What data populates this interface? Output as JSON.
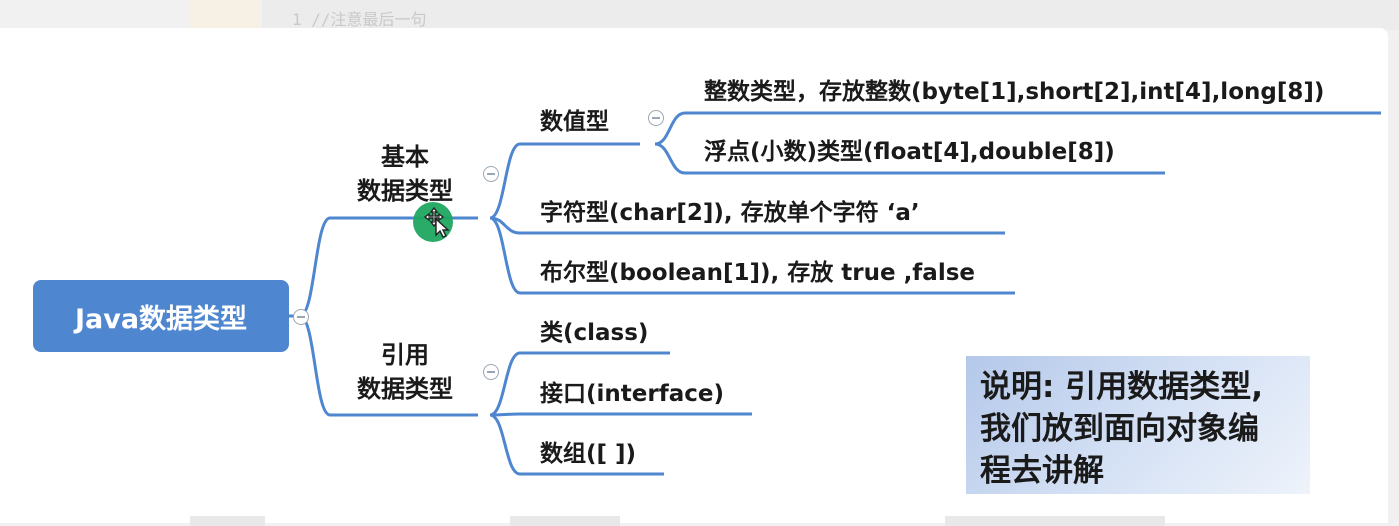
{
  "code_line": "1  //注意最后一句",
  "root": {
    "label": "Java数据类型"
  },
  "categories": {
    "primitive": {
      "line1": "基本",
      "line2": "数据类型"
    },
    "reference": {
      "line1": "引用",
      "line2": "数据类型"
    }
  },
  "numeric": {
    "label": "数值型"
  },
  "leaves": {
    "integer": "整数类型，存放整数(byte[1],short[2],int[4],long[8])",
    "float": "浮点(小数)类型(float[4],double[8])",
    "char": "字符型(char[2]), 存放单个字符  ‘a’",
    "boolean": "布尔型(boolean[1]), 存放 true ,false",
    "class": "类(class)",
    "interface": "接口(interface)",
    "array": "数组([ ])"
  },
  "note": {
    "line1": "说明: 引用数据类型,",
    "line2": "我们放到面向对象编",
    "line3": "程去讲解"
  },
  "colors": {
    "root_bg": "#4e86cf",
    "line": "#4e86cf",
    "cursor": "#1fa760"
  }
}
